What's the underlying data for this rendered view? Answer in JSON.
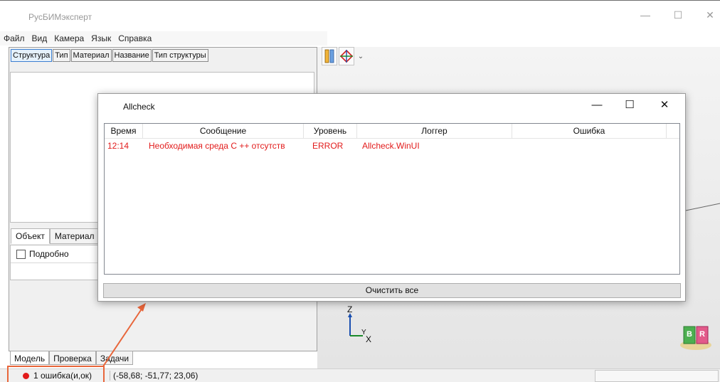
{
  "app": {
    "title": "РусБИМэксперт",
    "window_controls": {
      "minimize": "—",
      "maximize": "☐",
      "close": "✕"
    }
  },
  "menu": [
    "Файл",
    "Вид",
    "Камера",
    "Язык",
    "Справка"
  ],
  "structure_tabs": [
    "Структура",
    "Тип",
    "Материал",
    "Название",
    "Тип структуры"
  ],
  "object_tabs": [
    "Объект",
    "Материал"
  ],
  "object_panel": {
    "detail_checkbox_label": "Подробно",
    "detail_checked": false
  },
  "bottom_tabs": [
    "Модель",
    "Проверка",
    "Задачи"
  ],
  "status": {
    "error_count_text": "1 ошибка(и,ок)",
    "coordinates": "(-58,68; -51,77; 23,06)"
  },
  "viewport": {
    "axis_z": "Z",
    "axis_y": "Y",
    "axis_x": "X",
    "cube_faces": [
      "B",
      "R"
    ]
  },
  "dialog": {
    "title": "Allcheck",
    "controls": {
      "minimize": "—",
      "maximize": "☐",
      "close": "✕"
    },
    "columns": [
      "Время",
      "Сообщение",
      "Уровень",
      "Логгер",
      "Ошибка"
    ],
    "rows": [
      {
        "time": "12:14",
        "message": "Необходимая среда C ++ отсутств",
        "level": "ERROR",
        "logger": "Allcheck.WinUI",
        "error": ""
      }
    ],
    "clear_button": "Очистить все"
  },
  "colors": {
    "error": "#e21b1b",
    "annotation": "#e8663b",
    "tab_active": "#3c7fd1"
  }
}
